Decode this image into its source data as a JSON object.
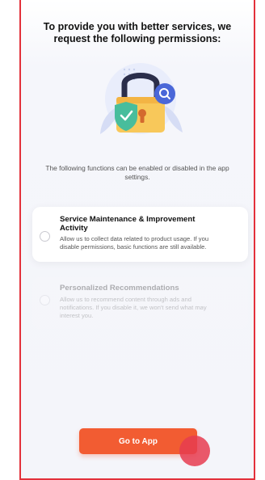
{
  "header": {
    "title_line1": "To provide you with better services, we",
    "title_line2": "request the following permissions:"
  },
  "illustration": {
    "name": "padlock-with-shield-and-magnifier",
    "colors": {
      "lock_body": "#f8c85a",
      "shackle": "#2b2e4a",
      "shield": "#48bd9c",
      "magnifier": "#4a67d8",
      "leaves": "#d6ddf5"
    }
  },
  "intro": {
    "line1": "The following functions can be enabled or disabled in the app",
    "line2": "settings."
  },
  "permissions": [
    {
      "title_line1": "Service Maintenance & Improvement",
      "title_line2": "Activity",
      "desc_line1": "Allow us to collect data related to product usage. If you",
      "desc_line2": "disable permissions, basic functions are still available.",
      "selected": false
    },
    {
      "title_line1": "Personalized Recommendations",
      "desc_line1": "Allow us to recommend content through ads and",
      "desc_line2": "notifications. If you disable it, we won't send what may",
      "desc_line3": "interest you.",
      "selected": false
    }
  ],
  "footer": {
    "go_button_label": "Go to App",
    "accent_color": "#f25c32",
    "frame_color": "#e3313b"
  }
}
